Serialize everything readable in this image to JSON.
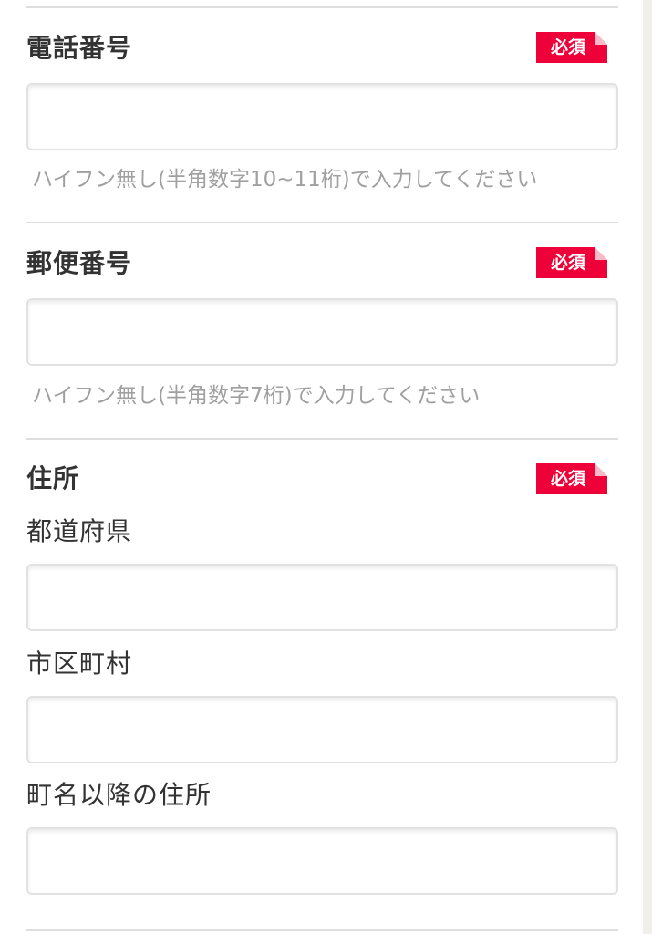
{
  "phone": {
    "title": "電話番号",
    "required_label": "必須",
    "input_value": "",
    "hint": "ハイフン無し(半角数字10~11桁)で入力してください"
  },
  "postal": {
    "title": "郵便番号",
    "required_label": "必須",
    "input_value": "",
    "hint": "ハイフン無し(半角数字7桁)で入力してください"
  },
  "address": {
    "title": "住所",
    "required_label": "必須",
    "prefecture_label": "都道府県",
    "prefecture_value": "",
    "city_label": "市区町村",
    "city_value": "",
    "street_label": "町名以降の住所",
    "street_value": ""
  },
  "colors": {
    "required_badge": "#ee0038",
    "hint_text": "#a0a0a0",
    "divider": "#dedede",
    "right_strip": "#f1efe9"
  }
}
